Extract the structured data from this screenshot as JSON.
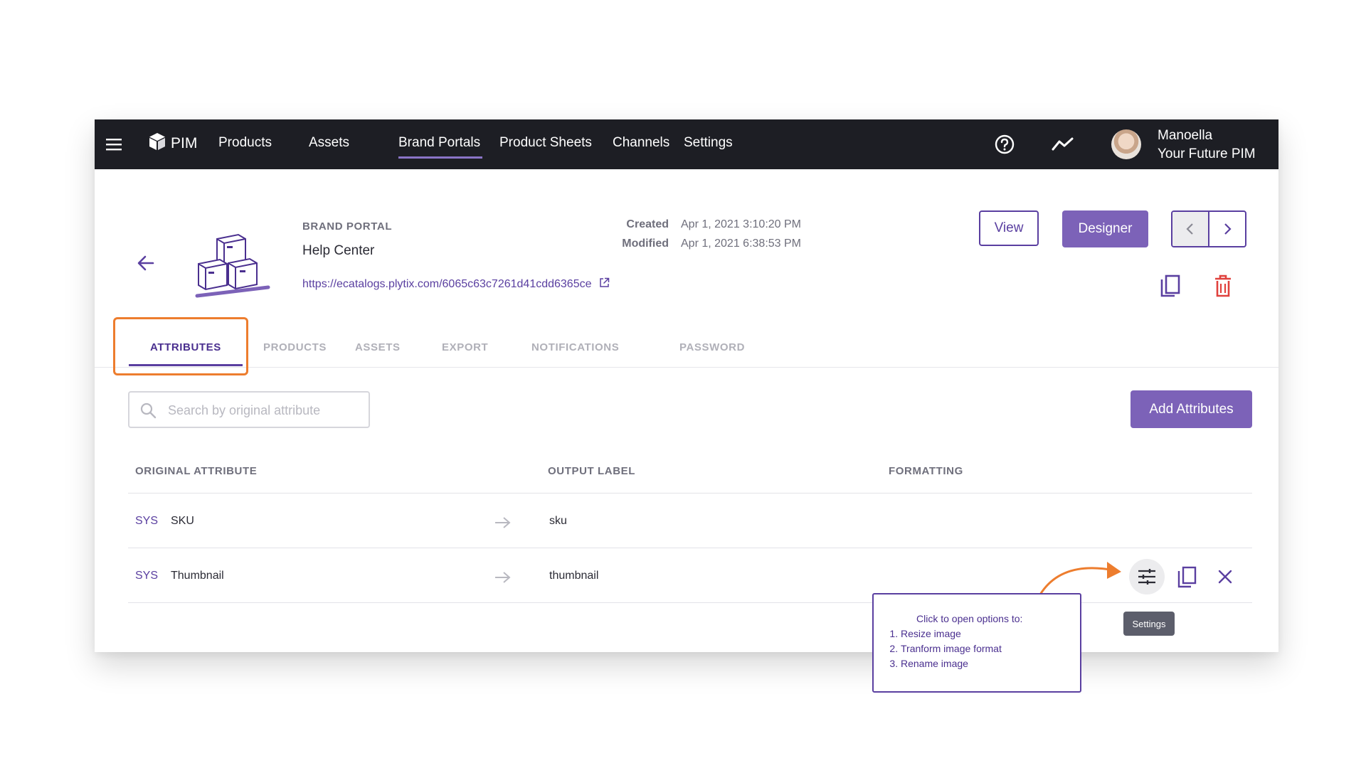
{
  "topbar": {
    "brand": "PIM",
    "nav": [
      "Products",
      "Assets",
      "Brand Portals",
      "Product Sheets",
      "Channels",
      "Settings"
    ],
    "active_nav": "Brand Portals",
    "user_name": "Manoella",
    "user_subtitle": "Your Future PIM"
  },
  "portal": {
    "kind": "BRAND PORTAL",
    "name": "Help Center",
    "url": "https://ecatalogs.plytix.com/6065c63c7261d41cdd6365ce",
    "created_label": "Created",
    "created_value": "Apr 1, 2021 3:10:20 PM",
    "modified_label": "Modified",
    "modified_value": "Apr 1, 2021 6:38:53 PM",
    "view_label": "View",
    "designer_label": "Designer"
  },
  "tabs": [
    "ATTRIBUTES",
    "PRODUCTS",
    "ASSETS",
    "EXPORT",
    "NOTIFICATIONS",
    "PASSWORD"
  ],
  "active_tab": "ATTRIBUTES",
  "search": {
    "placeholder": "Search by original attribute",
    "value": ""
  },
  "add_attributes_label": "Add Attributes",
  "table": {
    "headers": [
      "ORIGINAL ATTRIBUTE",
      "OUTPUT LABEL",
      "FORMATTING"
    ],
    "rows": [
      {
        "source": "SYS",
        "attribute": "SKU",
        "output": "sku"
      },
      {
        "source": "SYS",
        "attribute": "Thumbnail",
        "output": "thumbnail"
      }
    ]
  },
  "tooltip": "Settings",
  "callout": {
    "intro": "Click to open options to:",
    "items": [
      "Resize image",
      "Tranform image format",
      "Rename image"
    ]
  },
  "colors": {
    "topbar": "#1d1e24",
    "primary": "#7c62b8",
    "accent_text": "#5a3fa0",
    "highlight": "#ed7d2e",
    "delete": "#e0413d"
  }
}
